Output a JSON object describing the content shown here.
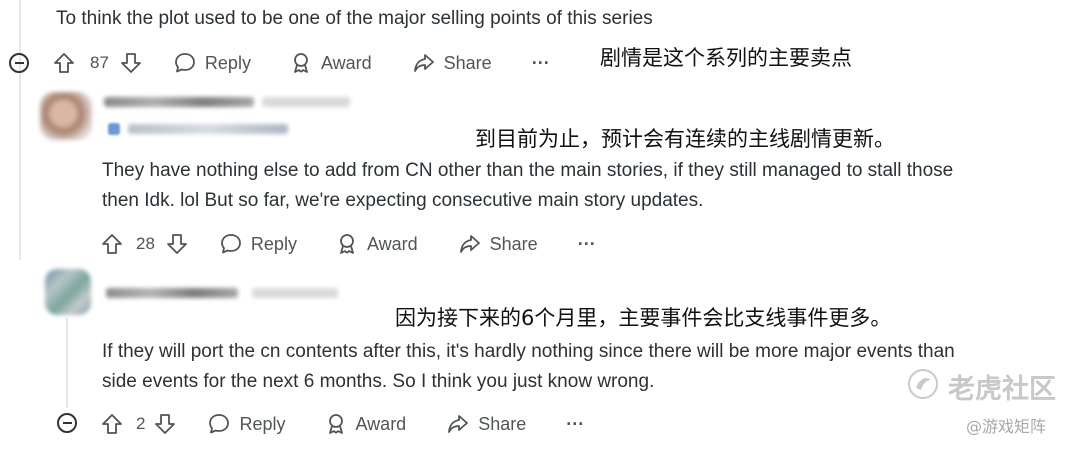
{
  "comment0": {
    "text": "To think the plot used to be one of the major selling points of this series",
    "votes": "87",
    "reply_label": "Reply",
    "award_label": "Award",
    "share_label": "Share",
    "more_label": "···",
    "annotation": "剧情是这个系列的主要卖点"
  },
  "comment1": {
    "annotation": "到目前为止，预计会有连续的主线剧情更新。",
    "lines": [
      "They have nothing else to add from CN other than the main stories, if they still managed to stall those",
      "then Idk. lol But so far, we're expecting consecutive main story updates."
    ],
    "votes": "28",
    "reply_label": "Reply",
    "award_label": "Award",
    "share_label": "Share",
    "more_label": "···"
  },
  "comment2": {
    "annotation": "因为接下来的6个月里，主要事件会比支线事件更多。",
    "lines": [
      "If they will port the cn contents after this, it's hardly nothing since there will be more major events than",
      "side events for the next 6 months. So I think you just know wrong."
    ],
    "votes": "2",
    "reply_label": "Reply",
    "award_label": "Award",
    "share_label": "Share",
    "more_label": "···"
  },
  "watermark": {
    "brand": "老虎社区",
    "handle": "@游戏矩阵"
  }
}
